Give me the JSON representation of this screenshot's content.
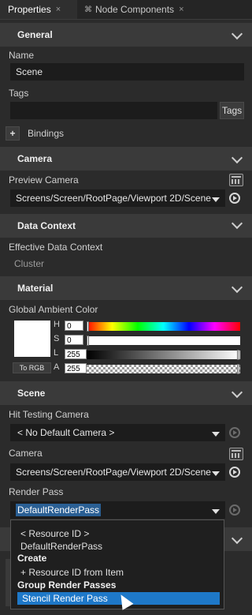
{
  "tabs": [
    {
      "label": "Properties",
      "close": "×"
    },
    {
      "label": "Node Components",
      "close": "×"
    }
  ],
  "sections": {
    "general": "General",
    "camera": "Camera",
    "data_context": "Data Context",
    "material": "Material",
    "scene": "Scene"
  },
  "general": {
    "name_label": "Name",
    "name_value": "Scene",
    "tags_label": "Tags",
    "tags_button": "Tags",
    "add_glyph": "+",
    "bindings_label": "Bindings"
  },
  "camera": {
    "preview_label": "Preview Camera",
    "preview_value": "Screens/Screen/RootPage/Viewport 2D/Scene"
  },
  "data_context": {
    "effective_label": "Effective Data Context",
    "effective_value": "Cluster"
  },
  "material": {
    "ambient_label": "Global Ambient Color",
    "to_rgb": "To RGB",
    "channels": [
      {
        "name": "H",
        "value": "0"
      },
      {
        "name": "S",
        "value": "0"
      },
      {
        "name": "L",
        "value": "255"
      },
      {
        "name": "A",
        "value": "255"
      }
    ]
  },
  "scene": {
    "hit_testing_label": "Hit Testing Camera",
    "hit_testing_value": "< No Default Camera >",
    "camera_label": "Camera",
    "camera_value": "Screens/Screen/RootPage/Viewport 2D/Scene",
    "render_pass_label": "Render Pass",
    "render_pass_value": "DefaultRenderPass"
  },
  "dropdown": {
    "items": [
      {
        "type": "item",
        "label": "< Resource ID >"
      },
      {
        "type": "item",
        "label": "DefaultRenderPass"
      },
      {
        "type": "header",
        "label": "Create"
      },
      {
        "type": "item",
        "label": "+ Resource ID from Item"
      },
      {
        "type": "header",
        "label": "Group Render Passes"
      },
      {
        "type": "selected",
        "label": "Stencil Render Pass"
      }
    ]
  },
  "colors": {
    "accent": "#1e78c8",
    "background": "#2b2b2b",
    "section": "#3a3a3a"
  },
  "icons": [
    "close-icon",
    "node-components-icon",
    "chevron-down-icon",
    "browse-icon",
    "navigate-icon",
    "cursor-icon"
  ]
}
